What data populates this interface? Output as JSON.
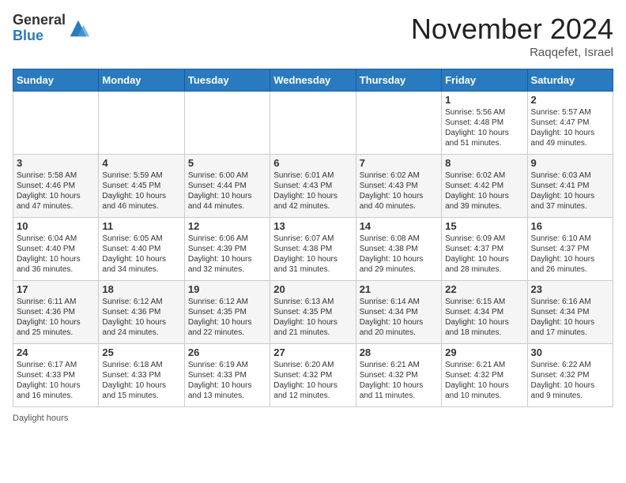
{
  "header": {
    "logo_general": "General",
    "logo_blue": "Blue",
    "month_title": "November 2024",
    "location": "Raqqefet, Israel"
  },
  "weekdays": [
    "Sunday",
    "Monday",
    "Tuesday",
    "Wednesday",
    "Thursday",
    "Friday",
    "Saturday"
  ],
  "weeks": [
    [
      {
        "day": "",
        "lines": []
      },
      {
        "day": "",
        "lines": []
      },
      {
        "day": "",
        "lines": []
      },
      {
        "day": "",
        "lines": []
      },
      {
        "day": "",
        "lines": []
      },
      {
        "day": "1",
        "lines": [
          "Sunrise: 5:56 AM",
          "Sunset: 4:48 PM",
          "Daylight: 10 hours",
          "and 51 minutes."
        ]
      },
      {
        "day": "2",
        "lines": [
          "Sunrise: 5:57 AM",
          "Sunset: 4:47 PM",
          "Daylight: 10 hours",
          "and 49 minutes."
        ]
      }
    ],
    [
      {
        "day": "3",
        "lines": [
          "Sunrise: 5:58 AM",
          "Sunset: 4:46 PM",
          "Daylight: 10 hours",
          "and 47 minutes."
        ]
      },
      {
        "day": "4",
        "lines": [
          "Sunrise: 5:59 AM",
          "Sunset: 4:45 PM",
          "Daylight: 10 hours",
          "and 46 minutes."
        ]
      },
      {
        "day": "5",
        "lines": [
          "Sunrise: 6:00 AM",
          "Sunset: 4:44 PM",
          "Daylight: 10 hours",
          "and 44 minutes."
        ]
      },
      {
        "day": "6",
        "lines": [
          "Sunrise: 6:01 AM",
          "Sunset: 4:43 PM",
          "Daylight: 10 hours",
          "and 42 minutes."
        ]
      },
      {
        "day": "7",
        "lines": [
          "Sunrise: 6:02 AM",
          "Sunset: 4:43 PM",
          "Daylight: 10 hours",
          "and 40 minutes."
        ]
      },
      {
        "day": "8",
        "lines": [
          "Sunrise: 6:02 AM",
          "Sunset: 4:42 PM",
          "Daylight: 10 hours",
          "and 39 minutes."
        ]
      },
      {
        "day": "9",
        "lines": [
          "Sunrise: 6:03 AM",
          "Sunset: 4:41 PM",
          "Daylight: 10 hours",
          "and 37 minutes."
        ]
      }
    ],
    [
      {
        "day": "10",
        "lines": [
          "Sunrise: 6:04 AM",
          "Sunset: 4:40 PM",
          "Daylight: 10 hours",
          "and 36 minutes."
        ]
      },
      {
        "day": "11",
        "lines": [
          "Sunrise: 6:05 AM",
          "Sunset: 4:40 PM",
          "Daylight: 10 hours",
          "and 34 minutes."
        ]
      },
      {
        "day": "12",
        "lines": [
          "Sunrise: 6:06 AM",
          "Sunset: 4:39 PM",
          "Daylight: 10 hours",
          "and 32 minutes."
        ]
      },
      {
        "day": "13",
        "lines": [
          "Sunrise: 6:07 AM",
          "Sunset: 4:38 PM",
          "Daylight: 10 hours",
          "and 31 minutes."
        ]
      },
      {
        "day": "14",
        "lines": [
          "Sunrise: 6:08 AM",
          "Sunset: 4:38 PM",
          "Daylight: 10 hours",
          "and 29 minutes."
        ]
      },
      {
        "day": "15",
        "lines": [
          "Sunrise: 6:09 AM",
          "Sunset: 4:37 PM",
          "Daylight: 10 hours",
          "and 28 minutes."
        ]
      },
      {
        "day": "16",
        "lines": [
          "Sunrise: 6:10 AM",
          "Sunset: 4:37 PM",
          "Daylight: 10 hours",
          "and 26 minutes."
        ]
      }
    ],
    [
      {
        "day": "17",
        "lines": [
          "Sunrise: 6:11 AM",
          "Sunset: 4:36 PM",
          "Daylight: 10 hours",
          "and 25 minutes."
        ]
      },
      {
        "day": "18",
        "lines": [
          "Sunrise: 6:12 AM",
          "Sunset: 4:36 PM",
          "Daylight: 10 hours",
          "and 24 minutes."
        ]
      },
      {
        "day": "19",
        "lines": [
          "Sunrise: 6:12 AM",
          "Sunset: 4:35 PM",
          "Daylight: 10 hours",
          "and 22 minutes."
        ]
      },
      {
        "day": "20",
        "lines": [
          "Sunrise: 6:13 AM",
          "Sunset: 4:35 PM",
          "Daylight: 10 hours",
          "and 21 minutes."
        ]
      },
      {
        "day": "21",
        "lines": [
          "Sunrise: 6:14 AM",
          "Sunset: 4:34 PM",
          "Daylight: 10 hours",
          "and 20 minutes."
        ]
      },
      {
        "day": "22",
        "lines": [
          "Sunrise: 6:15 AM",
          "Sunset: 4:34 PM",
          "Daylight: 10 hours",
          "and 18 minutes."
        ]
      },
      {
        "day": "23",
        "lines": [
          "Sunrise: 6:16 AM",
          "Sunset: 4:34 PM",
          "Daylight: 10 hours",
          "and 17 minutes."
        ]
      }
    ],
    [
      {
        "day": "24",
        "lines": [
          "Sunrise: 6:17 AM",
          "Sunset: 4:33 PM",
          "Daylight: 10 hours",
          "and 16 minutes."
        ]
      },
      {
        "day": "25",
        "lines": [
          "Sunrise: 6:18 AM",
          "Sunset: 4:33 PM",
          "Daylight: 10 hours",
          "and 15 minutes."
        ]
      },
      {
        "day": "26",
        "lines": [
          "Sunrise: 6:19 AM",
          "Sunset: 4:33 PM",
          "Daylight: 10 hours",
          "and 13 minutes."
        ]
      },
      {
        "day": "27",
        "lines": [
          "Sunrise: 6:20 AM",
          "Sunset: 4:32 PM",
          "Daylight: 10 hours",
          "and 12 minutes."
        ]
      },
      {
        "day": "28",
        "lines": [
          "Sunrise: 6:21 AM",
          "Sunset: 4:32 PM",
          "Daylight: 10 hours",
          "and 11 minutes."
        ]
      },
      {
        "day": "29",
        "lines": [
          "Sunrise: 6:21 AM",
          "Sunset: 4:32 PM",
          "Daylight: 10 hours",
          "and 10 minutes."
        ]
      },
      {
        "day": "30",
        "lines": [
          "Sunrise: 6:22 AM",
          "Sunset: 4:32 PM",
          "Daylight: 10 hours",
          "and 9 minutes."
        ]
      }
    ]
  ],
  "footer": {
    "daylight_label": "Daylight hours"
  }
}
